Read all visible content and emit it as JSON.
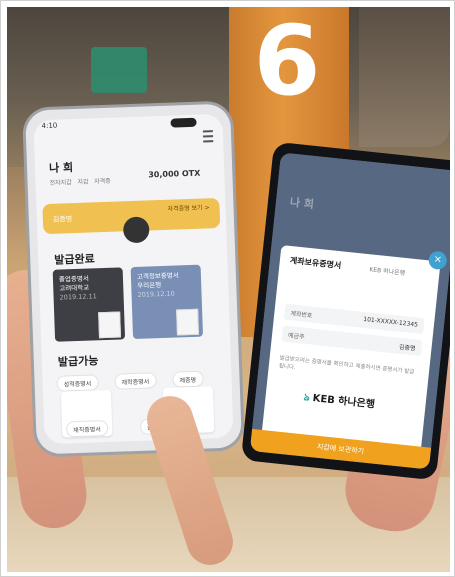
{
  "background": {
    "big_number": "6"
  },
  "left_phone": {
    "status_time": "4:10",
    "user_name": "나 희",
    "points": "30,000 OTX",
    "sub_items": [
      "전자지갑",
      "지갑",
      "자격증"
    ],
    "card_label": "김증명",
    "card_subtext": "자격증명 보기 >",
    "section_issued": "발급완료",
    "issued_cards": [
      {
        "title": "졸업증명서",
        "subtitle": "고려대학교",
        "tail": "2019.12.11"
      },
      {
        "title": "고객정보증명서",
        "subtitle": "우리은행",
        "tail": "2019.12.10"
      }
    ],
    "section_available": "발급가능",
    "available_pills": [
      "성적증명서",
      "재학증명서",
      "제증명",
      "재직증명서",
      "출입증명서"
    ]
  },
  "right_phone": {
    "header_title": "나 희",
    "modal": {
      "title": "계좌보유증명서",
      "bank_tag": "KEB 하나은행",
      "fields": [
        {
          "label": "계좌번호",
          "value": "101-XXXXX-12345"
        },
        {
          "label": "예금주",
          "value": "김증명"
        }
      ],
      "note": "발급받으려는 증명서를 확인하고 제출하시면 증명서가 발급됩니다.",
      "logo_text": "KEB 하나은행",
      "button_label": "지갑에 보관하기"
    }
  },
  "colors": {
    "accent_yellow": "#f0c050",
    "accent_orange": "#f0a21e",
    "teal": "#1aa598"
  }
}
